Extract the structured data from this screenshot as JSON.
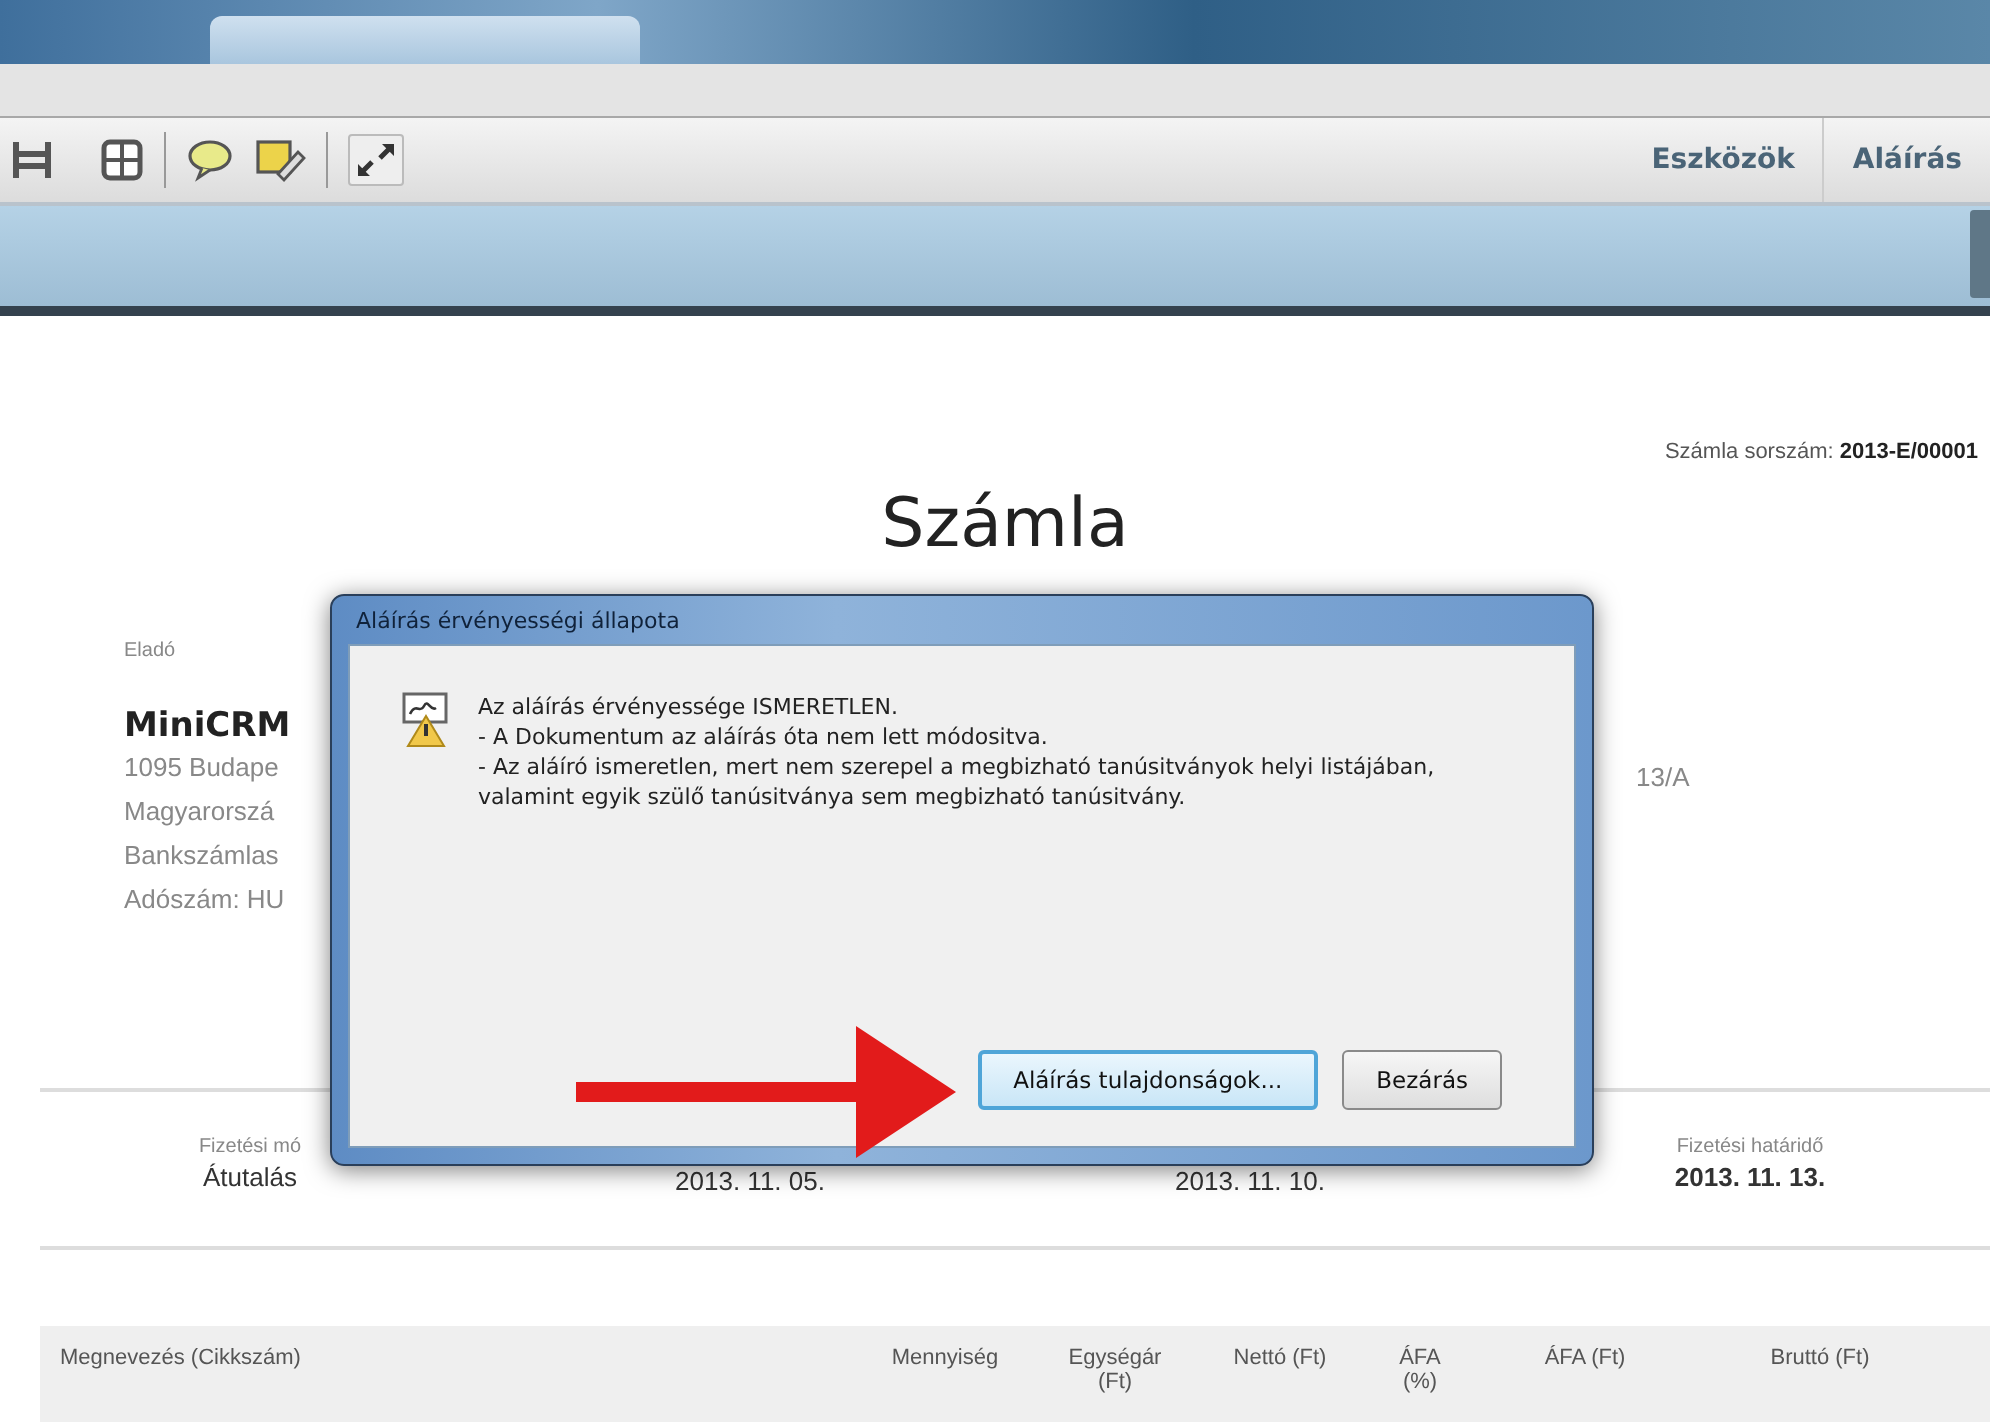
{
  "toolbar": {
    "menu": [
      {
        "label": "Eszközök",
        "selected": false
      },
      {
        "label": "Aláírás",
        "selected": false
      }
    ]
  },
  "invoice": {
    "number_label": "Számla sorszám:",
    "number": "2013-E/00001",
    "title": "Számla",
    "seller": {
      "heading": "Eladó",
      "name": "MiniCRM",
      "lines": [
        "1095 Budape",
        "Magyarorszá",
        "Bankszámlas",
        "Adószám: HU"
      ]
    },
    "buyer": {
      "lines": [
        "13/A"
      ]
    },
    "payment": [
      {
        "label": "Fizetési mó",
        "value": "Átutalás"
      },
      {
        "value": "2013. 11. 05."
      },
      {
        "value": "2013. 11. 10."
      },
      {
        "label": "Fizetési határidő",
        "value": "2013. 11. 13."
      }
    ],
    "table": {
      "columns": [
        "Megnevezés (Cikkszám)",
        "Mennyiség",
        "Egységár (Ft)",
        "Nettó (Ft)",
        "ÁFA (%)",
        "ÁFA (Ft)",
        "Bruttó (Ft)"
      ]
    }
  },
  "dialog": {
    "title": "Aláírás érvényességi állapota",
    "message": [
      "Az aláírás érvényessége ISMERETLEN.",
      "- A Dokumentum az aláírás óta nem lett módositva.",
      "- Az aláíró ismeretlen, mert nem szerepel a megbizható tanúsitványok helyi listájában, valamint egyik szülő tanúsitványa sem megbizható tanúsitvány."
    ],
    "buttons": [
      {
        "label": "Aláírás tulajdonságok...",
        "default": true
      },
      {
        "label": "Bezárás",
        "default": false
      }
    ]
  }
}
